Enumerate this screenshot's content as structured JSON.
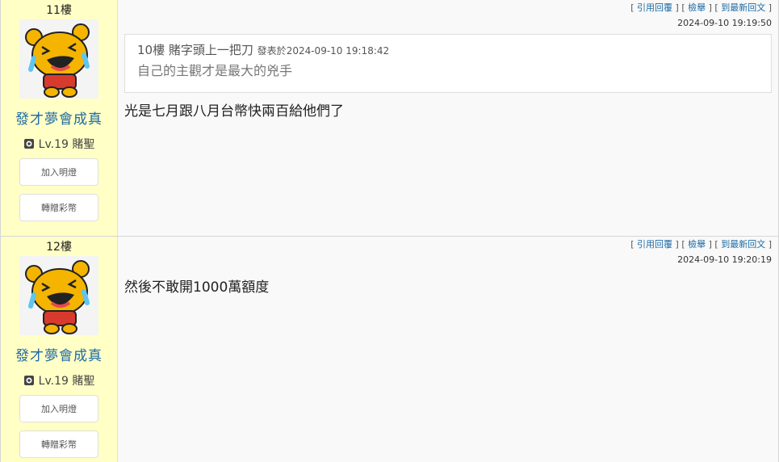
{
  "posts": [
    {
      "floor": "11樓",
      "user": {
        "name": "發才夢會成真",
        "level": "Lv.19 賭聖"
      },
      "buttons": {
        "follow": "加入明燈",
        "gift": "轉贈彩幣"
      },
      "actions": {
        "quote_reply": "引用回覆",
        "report": "檢舉",
        "latest": "到最新回文"
      },
      "time": "2024-09-10 19:19:50",
      "quote": {
        "floor": "10樓",
        "author": "賭字頭上一把刀",
        "posted_prefix": "發表於",
        "posted_time": "2024-09-10 19:18:42",
        "body": "自己的主觀才是最大的兇手"
      },
      "body": "光是七月跟八月台幣快兩百給他們了"
    },
    {
      "floor": "12樓",
      "user": {
        "name": "發才夢會成真",
        "level": "Lv.19 賭聖"
      },
      "buttons": {
        "follow": "加入明燈",
        "gift": "轉贈彩幣"
      },
      "actions": {
        "quote_reply": "引用回覆",
        "report": "檢舉",
        "latest": "到最新回文"
      },
      "time": "2024-09-10 19:20:19",
      "body": "然後不敢開1000萬額度"
    }
  ],
  "icons": {
    "avatar": "crying-laughing-bear-avatar",
    "level": "level-badge-icon"
  },
  "colors": {
    "sidebar_bg": "#ffffc6",
    "username": "#1d6aa5",
    "link": "#1d6aa5"
  }
}
